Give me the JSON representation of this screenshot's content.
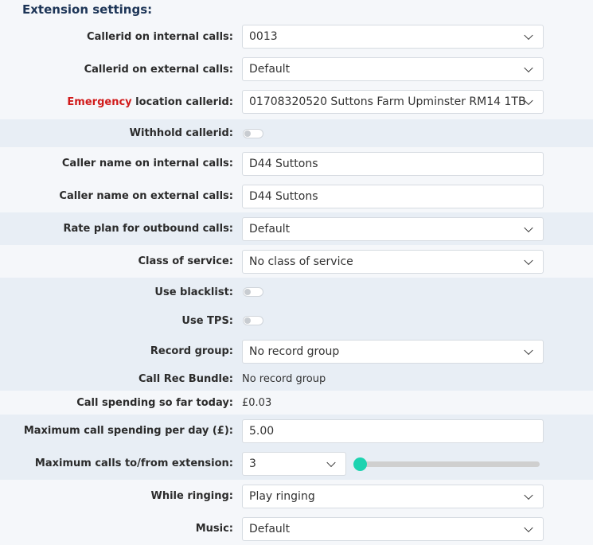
{
  "section_title": "Extension settings:",
  "rows": {
    "callerid_internal": {
      "label": "Callerid on internal calls:",
      "value": "0013"
    },
    "callerid_external": {
      "label": "Callerid on external calls:",
      "value": "Default"
    },
    "emergency_callerid": {
      "label_highlight": "Emergency",
      "label_rest": " location callerid:",
      "value": "01708320520 Suttons Farm Upminster RM14 1TB"
    },
    "withhold_callerid": {
      "label": "Withhold callerid:",
      "checked": false
    },
    "caller_name_internal": {
      "label": "Caller name on internal calls:",
      "value": "D44 Suttons"
    },
    "caller_name_external": {
      "label": "Caller name on external calls:",
      "value": "D44 Suttons"
    },
    "rate_plan": {
      "label": "Rate plan for outbound calls:",
      "value": "Default"
    },
    "class_of_service": {
      "label": "Class of service:",
      "value": "No class of service"
    },
    "use_blacklist": {
      "label": "Use blacklist:",
      "checked": false
    },
    "use_tps": {
      "label": "Use TPS:",
      "checked": false
    },
    "record_group": {
      "label": "Record group:",
      "value": "No record group"
    },
    "call_rec_bundle": {
      "label": "Call Rec Bundle:",
      "value": "No record group"
    },
    "call_spending_today": {
      "label": "Call spending so far today:",
      "value": "£0.03"
    },
    "max_spending": {
      "label": "Maximum call spending per day (£):",
      "value": "5.00"
    },
    "max_calls": {
      "label": "Maximum calls to/from extension:",
      "value": "3"
    },
    "while_ringing": {
      "label": "While ringing:",
      "value": "Play ringing"
    },
    "music": {
      "label": "Music:",
      "value": "Default"
    }
  },
  "colors": {
    "accent_slider": "#1dd3b0",
    "emergency_red": "#d11a1a",
    "band": "#e8eef5",
    "title": "#1d3557"
  }
}
